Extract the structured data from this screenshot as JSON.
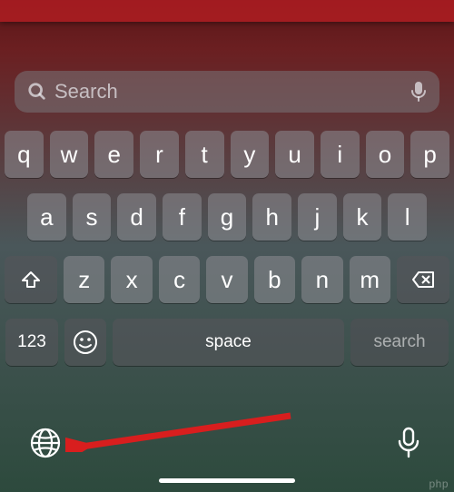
{
  "search": {
    "placeholder": "Search"
  },
  "keyboard": {
    "row1": [
      "q",
      "w",
      "e",
      "r",
      "t",
      "y",
      "u",
      "i",
      "o",
      "p"
    ],
    "row2": [
      "a",
      "s",
      "d",
      "f",
      "g",
      "h",
      "j",
      "k",
      "l"
    ],
    "row3": [
      "z",
      "x",
      "c",
      "v",
      "b",
      "n",
      "m"
    ],
    "numbers_label": "123",
    "space_label": "space",
    "search_label": "search"
  },
  "watermark": "php"
}
